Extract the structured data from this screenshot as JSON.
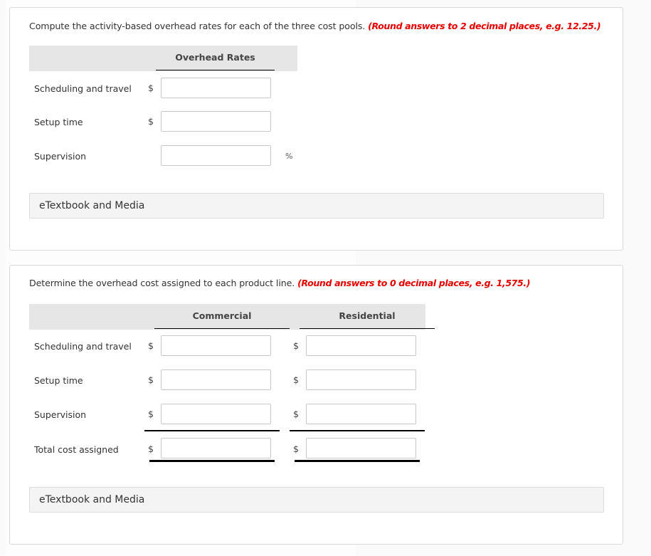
{
  "part1": {
    "prompt": "Compute the activity-based overhead rates for each of the three cost pools.",
    "hint": "(Round answers to 2 decimal places, e.g. 12.25.)",
    "column_header": "Overhead Rates",
    "rows": [
      {
        "label": "Scheduling and travel",
        "prefix": "$",
        "suffix": "",
        "value": ""
      },
      {
        "label": "Setup time",
        "prefix": "$",
        "suffix": "",
        "value": ""
      },
      {
        "label": "Supervision",
        "prefix": "",
        "suffix": "%",
        "value": ""
      }
    ],
    "etextbook_label": "eTextbook and Media"
  },
  "part2": {
    "prompt": "Determine the overhead cost assigned to each product line.",
    "hint": "(Round answers to 0 decimal places, e.g. 1,575.)",
    "columns": [
      "Commercial",
      "Residential"
    ],
    "rows": [
      {
        "label": "Scheduling and travel",
        "prefix": "$",
        "values": [
          "",
          ""
        ]
      },
      {
        "label": "Setup time",
        "prefix": "$",
        "values": [
          "",
          ""
        ]
      },
      {
        "label": "Supervision",
        "prefix": "$",
        "values": [
          "",
          ""
        ]
      },
      {
        "label": "Total cost assigned",
        "prefix": "$",
        "values": [
          "",
          ""
        ]
      }
    ],
    "etextbook_label": "eTextbook and Media"
  }
}
